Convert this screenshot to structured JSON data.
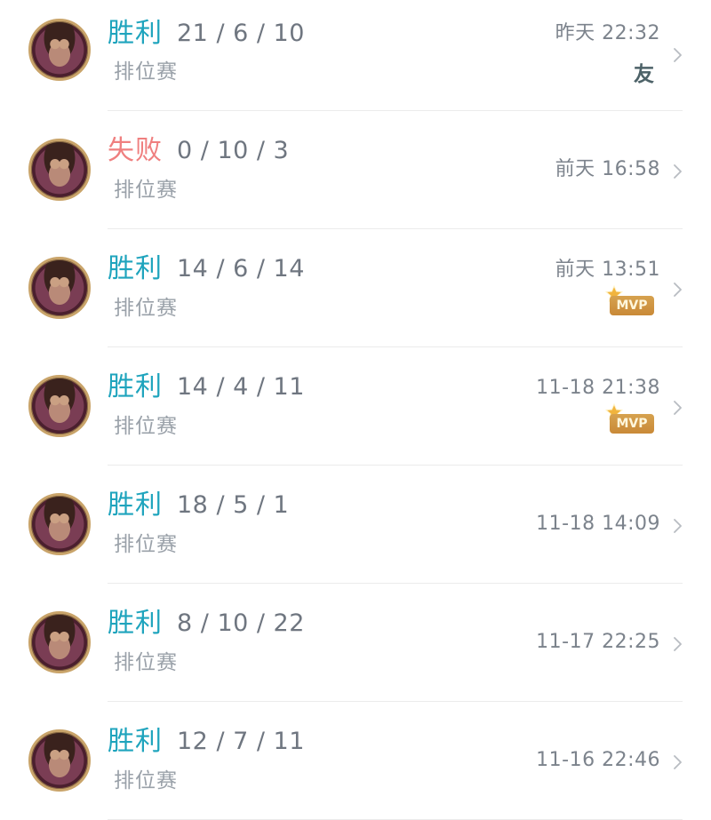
{
  "matches": [
    {
      "result": "胜利",
      "outcome": "win",
      "kda": "21 / 6 / 10",
      "mode": "排位赛",
      "time": "昨天 22:32",
      "badge": "friend",
      "badge_text": "友",
      "avatar_icon": "hero-avatar-icon"
    },
    {
      "result": "失败",
      "outcome": "lose",
      "kda": "0 / 10 / 3",
      "mode": "排位赛",
      "time": "前天 16:58",
      "badge": "none",
      "avatar_icon": "hero-avatar-icon"
    },
    {
      "result": "胜利",
      "outcome": "win",
      "kda": "14 / 6 / 14",
      "mode": "排位赛",
      "time": "前天 13:51",
      "badge": "mvp",
      "badge_text": "MVP",
      "avatar_icon": "hero-avatar-icon"
    },
    {
      "result": "胜利",
      "outcome": "win",
      "kda": "14 / 4 / 11",
      "mode": "排位赛",
      "time": "11-18 21:38",
      "badge": "mvp",
      "badge_text": "MVP",
      "avatar_icon": "hero-avatar-icon"
    },
    {
      "result": "胜利",
      "outcome": "win",
      "kda": "18 / 5 / 1",
      "mode": "排位赛",
      "time": "11-18 14:09",
      "badge": "none",
      "avatar_icon": "hero-avatar-icon"
    },
    {
      "result": "胜利",
      "outcome": "win",
      "kda": "8 / 10 / 22",
      "mode": "排位赛",
      "time": "11-17 22:25",
      "badge": "none",
      "avatar_icon": "hero-avatar-icon"
    },
    {
      "result": "胜利",
      "outcome": "win",
      "kda": "12 / 7 / 11",
      "mode": "排位赛",
      "time": "11-16 22:46",
      "badge": "none",
      "avatar_icon": "hero-avatar-icon"
    }
  ],
  "colors": {
    "win": "#1fa4bd",
    "lose": "#ef7f7f",
    "kda": "#6f7680",
    "mode": "#9aa1a9",
    "time": "#7c838c",
    "mvp_badge": "#d19746"
  },
  "icons": {
    "chevron": "chevron-right-icon",
    "mvp_star": "star-icon"
  }
}
